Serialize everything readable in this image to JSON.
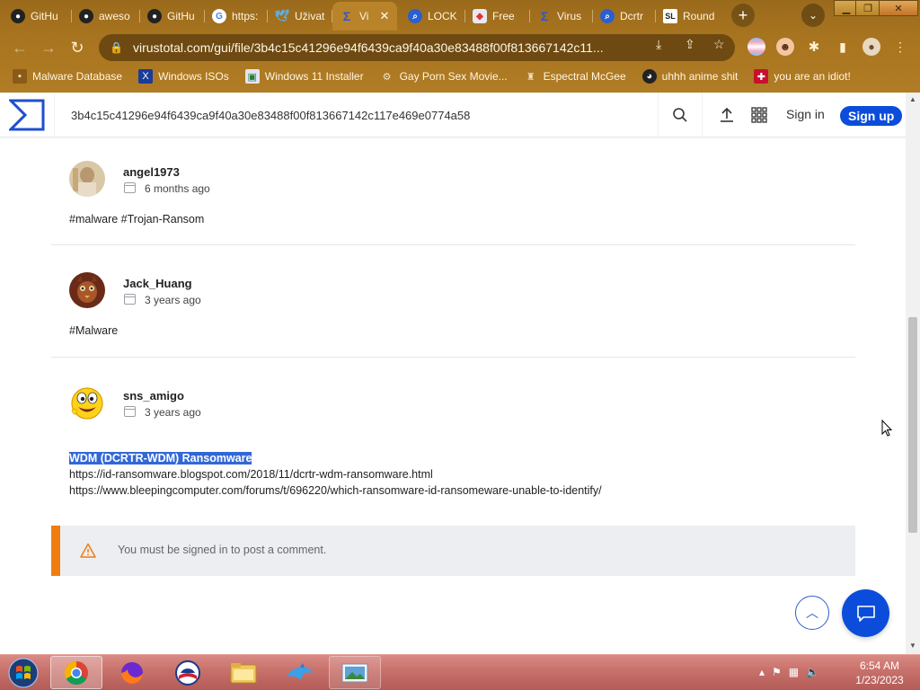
{
  "browser": {
    "tabs": [
      {
        "label": "GitHu",
        "icon": "github-icon"
      },
      {
        "label": "aweso",
        "icon": "github-icon"
      },
      {
        "label": "GitHu",
        "icon": "github-icon"
      },
      {
        "label": "https:",
        "icon": "google-icon"
      },
      {
        "label": "Uživat",
        "icon": "twitter-icon"
      },
      {
        "label": "Vi",
        "icon": "virustotal-icon",
        "active": true
      },
      {
        "label": "LOCK",
        "icon": "search-icon"
      },
      {
        "label": "Free",
        "icon": "app-icon"
      },
      {
        "label": "Virus",
        "icon": "virustotal-icon"
      },
      {
        "label": "Dcrtr",
        "icon": "search-icon"
      },
      {
        "label": "Round",
        "icon": "sl-icon"
      }
    ],
    "close_tab_glyph": "✕",
    "new_tab_glyph": "+",
    "url": "virustotal.com/gui/file/3b4c15c41296e94f6439ca9f40a30e83488f00f813667142c11...",
    "bookmarks": [
      {
        "label": "Malware Database"
      },
      {
        "label": "Windows ISOs"
      },
      {
        "label": "Windows 11 Installer"
      },
      {
        "label": "Gay Porn Sex Movie..."
      },
      {
        "label": "Espectral McGee"
      },
      {
        "label": "uhhh anime shit"
      },
      {
        "label": "you are an idiot!"
      }
    ]
  },
  "header": {
    "search_value": "3b4c15c41296e94f6439ca9f40a30e83488f00f813667142c117e469e0774a58",
    "signin_label": "Sign in",
    "signup_label": "Sign up"
  },
  "comments": [
    {
      "author": "angel1973",
      "time": "6 months ago",
      "body": "#malware #Trojan-Ransom"
    },
    {
      "author": "Jack_Huang",
      "time": "3 years ago",
      "body": "#Malware"
    },
    {
      "author": "sns_amigo",
      "time": "3 years ago",
      "title": "WDM (DCRTR-WDM) Ransomware",
      "links": [
        "https://id-ransomware.blogspot.com/2018/11/dcrtr-wdm-ransomware.html",
        "https://www.bleepingcomputer.com/forums/t/696220/which-ransomware-id-ransomeware-unable-to-identify/"
      ]
    }
  ],
  "notice": {
    "text": "You must be signed in to post a comment."
  },
  "taskbar": {
    "items": [
      "chrome",
      "firefox",
      "obama",
      "explorer",
      "dolphin",
      "photo-viewer"
    ],
    "clock_time": "6:54 AM",
    "clock_date": "1/23/2023"
  },
  "colors": {
    "accent": "#0b4dda",
    "notice_bar": "#ef7d10",
    "selection": "#3268d6"
  }
}
